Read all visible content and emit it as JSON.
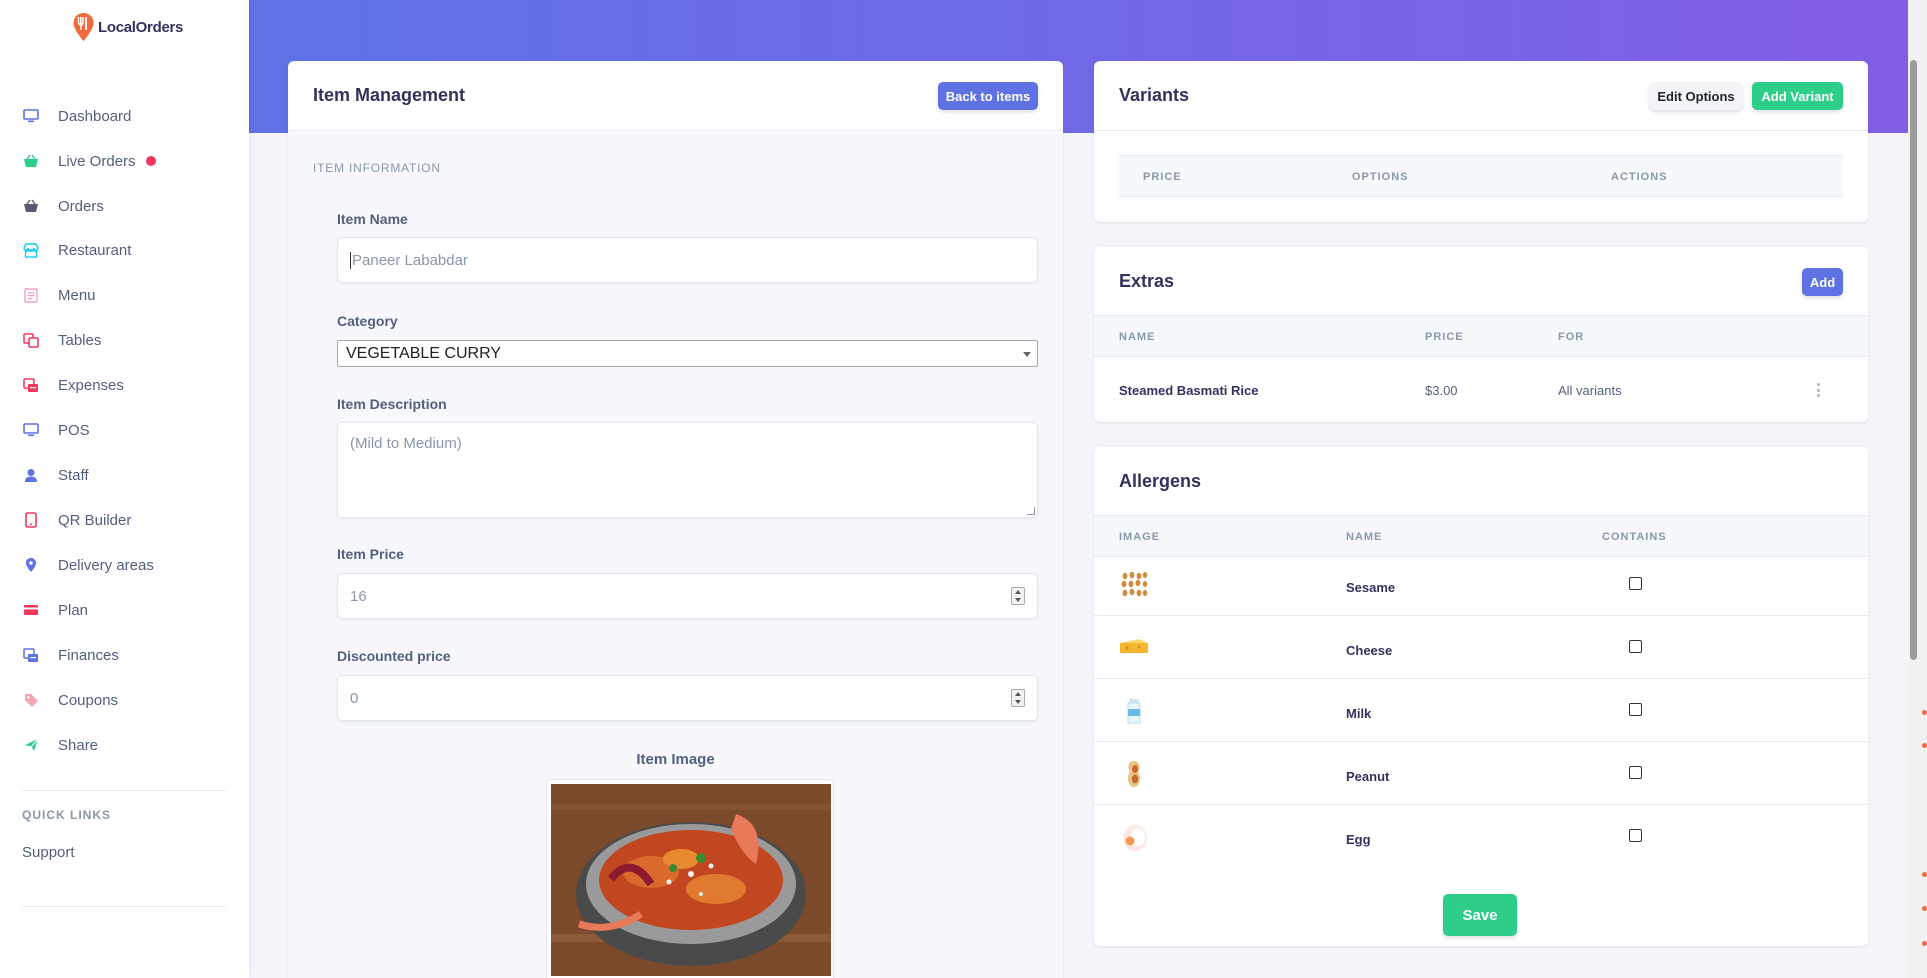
{
  "app": {
    "logo_text": "LocalOrders"
  },
  "sidebar": {
    "items": [
      {
        "label": "Dashboard",
        "icon": "monitor-icon"
      },
      {
        "label": "Live Orders",
        "icon": "basket-icon"
      },
      {
        "label": "Orders",
        "icon": "basket-icon"
      },
      {
        "label": "Restaurant",
        "icon": "shop-icon"
      },
      {
        "label": "Menu",
        "icon": "menu-icon"
      },
      {
        "label": "Tables",
        "icon": "tables-icon"
      },
      {
        "label": "Expenses",
        "icon": "expenses-icon"
      },
      {
        "label": "POS",
        "icon": "monitor-icon"
      },
      {
        "label": "Staff",
        "icon": "user-icon"
      },
      {
        "label": "QR Builder",
        "icon": "mobile-icon"
      },
      {
        "label": "Delivery areas",
        "icon": "pin-icon"
      },
      {
        "label": "Plan",
        "icon": "card-icon"
      },
      {
        "label": "Finances",
        "icon": "finances-icon"
      },
      {
        "label": "Coupons",
        "icon": "tag-icon"
      },
      {
        "label": "Share",
        "icon": "send-icon"
      }
    ],
    "quick_links_title": "QUICK LINKS",
    "support_label": "Support"
  },
  "item_card": {
    "title": "Item Management",
    "back_button": "Back to items",
    "section_label": "ITEM INFORMATION",
    "name_label": "Item Name",
    "name_placeholder": "Paneer Lababdar",
    "category_label": "Category",
    "category_value": "VEGETABLE CURRY",
    "description_label": "Item Description",
    "description_placeholder": "(Mild to Medium)",
    "price_label": "Item Price",
    "price_placeholder": "16",
    "discount_label": "Discounted price",
    "discount_placeholder": "0",
    "image_label": "Item Image"
  },
  "variants": {
    "title": "Variants",
    "edit_options_button": "Edit Options",
    "add_variant_button": "Add Variant",
    "columns": [
      "PRICE",
      "OPTIONS",
      "ACTIONS"
    ]
  },
  "extras": {
    "title": "Extras",
    "add_button": "Add",
    "columns": [
      "NAME",
      "PRICE",
      "FOR"
    ],
    "rows": [
      {
        "name": "Steamed Basmati Rice",
        "price": "$3.00",
        "for": "All variants"
      }
    ]
  },
  "allergens": {
    "title": "Allergens",
    "columns": [
      "IMAGE",
      "NAME",
      "CONTAINS"
    ],
    "rows": [
      {
        "name": "Sesame",
        "icon": "sesame-icon",
        "contains": false
      },
      {
        "name": "Cheese",
        "icon": "cheese-icon",
        "contains": false
      },
      {
        "name": "Milk",
        "icon": "milk-icon",
        "contains": false
      },
      {
        "name": "Peanut",
        "icon": "peanut-icon",
        "contains": false
      },
      {
        "name": "Egg",
        "icon": "egg-icon",
        "contains": false
      }
    ],
    "save_button": "Save"
  },
  "colors": {
    "primary": "#5e72e4",
    "success": "#2dce89",
    "danger": "#f5365c",
    "gradient_end": "#825ee4"
  }
}
